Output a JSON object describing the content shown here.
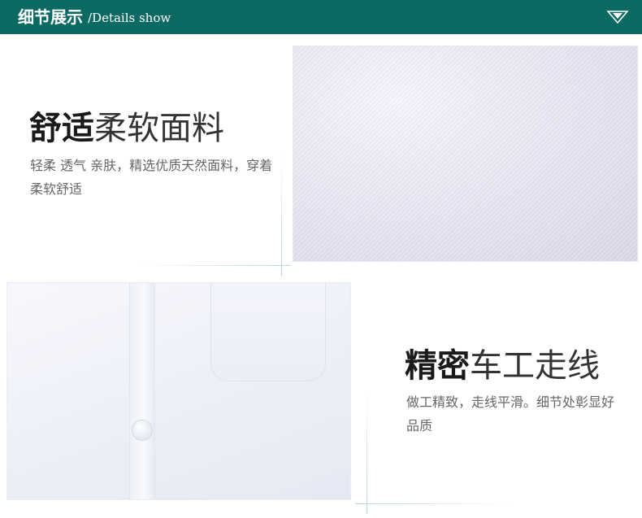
{
  "header": {
    "title": "细节展示",
    "subtitle": "/Details show",
    "arrow_icon": "chevron-down-icon",
    "background_color": "#0d6a63"
  },
  "section_comfort": {
    "heading_bold": "舒适",
    "heading_light": "柔软面料",
    "description": "轻柔 透气 亲肤，精选优质天然面料，穿着柔软舒适"
  },
  "section_stitching": {
    "heading_bold": "精密",
    "heading_light": "车工走线",
    "description": "做工精致，走线平滑。细节处彰显好品质"
  }
}
